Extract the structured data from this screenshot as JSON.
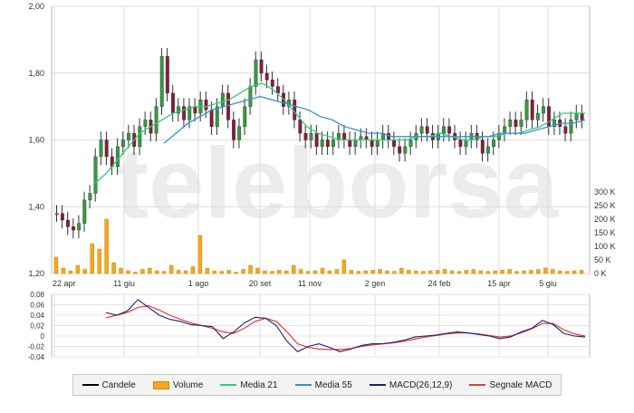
{
  "chart_data": {
    "type": "line",
    "watermark": "teleborsa",
    "price": {
      "y_ticks": [
        "2,00",
        "1,80",
        "1,60",
        "1,40",
        "1,20"
      ],
      "ylim": [
        1.2,
        2.0
      ]
    },
    "volume": {
      "y_ticks": [
        "300 K",
        "250 K",
        "200 K",
        "150 K",
        "100 K",
        "50 K",
        "0 K"
      ],
      "ylim": [
        0,
        300000
      ]
    },
    "x_ticks": [
      "22 apr",
      "11 giu",
      "1 ago",
      "20 set",
      "11 nov",
      "2 gen",
      "24 feb",
      "15 apr",
      "5 giu"
    ],
    "macd_panel": {
      "y_ticks": [
        "0,08",
        "0,06",
        "0,04",
        "0,02",
        "0",
        "-0,02",
        "-0,04"
      ],
      "ylim": [
        -0.04,
        0.08
      ]
    },
    "legend": [
      {
        "label": "Candele",
        "color": "#000000",
        "kind": "line"
      },
      {
        "label": "Volume",
        "color": "#f5a623",
        "kind": "box"
      },
      {
        "label": "Media 21",
        "color": "#33cc77",
        "kind": "line"
      },
      {
        "label": "Media 55",
        "color": "#3b8fd6",
        "kind": "line"
      },
      {
        "label": "MACD(26,12,9)",
        "color": "#1a237e",
        "kind": "line"
      },
      {
        "label": "Segnale MACD",
        "color": "#e53935",
        "kind": "line"
      }
    ],
    "candles_close_approx": [
      1.38,
      1.36,
      1.34,
      1.33,
      1.35,
      1.42,
      1.44,
      1.55,
      1.6,
      1.55,
      1.52,
      1.58,
      1.6,
      1.62,
      1.58,
      1.64,
      1.66,
      1.62,
      1.7,
      1.85,
      1.74,
      1.68,
      1.7,
      1.66,
      1.7,
      1.68,
      1.72,
      1.69,
      1.64,
      1.7,
      1.74,
      1.66,
      1.6,
      1.64,
      1.7,
      1.76,
      1.84,
      1.8,
      1.78,
      1.76,
      1.74,
      1.7,
      1.72,
      1.66,
      1.62,
      1.6,
      1.62,
      1.58,
      1.6,
      1.58,
      1.6,
      1.62,
      1.6,
      1.58,
      1.6,
      1.61,
      1.6,
      1.58,
      1.6,
      1.62,
      1.6,
      1.58,
      1.56,
      1.58,
      1.6,
      1.62,
      1.64,
      1.62,
      1.6,
      1.62,
      1.64,
      1.62,
      1.6,
      1.58,
      1.6,
      1.62,
      1.6,
      1.56,
      1.58,
      1.6,
      1.62,
      1.64,
      1.66,
      1.64,
      1.66,
      1.72,
      1.66,
      1.68,
      1.7,
      1.64,
      1.66,
      1.64,
      1.62,
      1.66,
      1.68,
      1.66
    ],
    "media21_approx": [
      1.47,
      1.5,
      1.54,
      1.58,
      1.62,
      1.64,
      1.66,
      1.68,
      1.69,
      1.7,
      1.7,
      1.71,
      1.72,
      1.74,
      1.76,
      1.77,
      1.75,
      1.72,
      1.68,
      1.64,
      1.62,
      1.61,
      1.6,
      1.6,
      1.6,
      1.6,
      1.6,
      1.6,
      1.6,
      1.61,
      1.61,
      1.62,
      1.61,
      1.6,
      1.6,
      1.61,
      1.61,
      1.62,
      1.62,
      1.63,
      1.64,
      1.66,
      1.68,
      1.68,
      1.68
    ],
    "media55_approx": [
      1.59,
      1.62,
      1.65,
      1.67,
      1.69,
      1.7,
      1.71,
      1.72,
      1.73,
      1.72,
      1.71,
      1.7,
      1.69,
      1.67,
      1.66,
      1.64,
      1.63,
      1.62,
      1.62,
      1.61,
      1.61,
      1.61,
      1.61,
      1.61,
      1.61,
      1.61,
      1.61,
      1.61,
      1.62,
      1.62,
      1.62,
      1.63,
      1.64,
      1.65,
      1.65,
      1.66
    ],
    "volume_approx": [
      60000,
      20000,
      10000,
      30000,
      15000,
      110000,
      90000,
      200000,
      40000,
      20000,
      10000,
      5000,
      15000,
      20000,
      10000,
      8000,
      30000,
      12000,
      10000,
      25000,
      140000,
      20000,
      10000,
      8000,
      12000,
      5000,
      15000,
      30000,
      20000,
      10000,
      8000,
      12000,
      10000,
      30000,
      15000,
      8000,
      10000,
      20000,
      10000,
      15000,
      50000,
      12000,
      8000,
      10000,
      12000,
      15000,
      10000,
      8000,
      20000,
      12000,
      10000,
      8000,
      10000,
      12000,
      15000,
      10000,
      8000,
      12000,
      15000,
      10000,
      8000,
      10000,
      12000,
      15000,
      8000,
      10000,
      12000,
      15000,
      20000,
      15000,
      10000,
      8000,
      10000,
      12000
    ],
    "macd_approx": [
      0.045,
      0.04,
      0.048,
      0.07,
      0.055,
      0.04,
      0.032,
      0.028,
      0.022,
      0.02,
      0.018,
      -0.005,
      0.008,
      0.025,
      0.036,
      0.034,
      0.02,
      -0.01,
      -0.03,
      -0.02,
      -0.015,
      -0.022,
      -0.03,
      -0.025,
      -0.018,
      -0.015,
      -0.015,
      -0.012,
      -0.008,
      -0.002,
      0.0,
      0.002,
      0.005,
      0.008,
      0.006,
      0.003,
      0.0,
      -0.005,
      -0.002,
      0.008,
      0.015,
      0.03,
      0.022,
      0.005,
      0.0,
      -0.002
    ],
    "signal_approx": [
      0.035,
      0.04,
      0.045,
      0.055,
      0.058,
      0.05,
      0.04,
      0.032,
      0.025,
      0.02,
      0.015,
      0.008,
      0.005,
      0.015,
      0.028,
      0.034,
      0.028,
      0.008,
      -0.015,
      -0.022,
      -0.025,
      -0.026,
      -0.026,
      -0.024,
      -0.02,
      -0.017,
      -0.015,
      -0.013,
      -0.01,
      -0.006,
      -0.002,
      0.001,
      0.004,
      0.006,
      0.006,
      0.004,
      0.001,
      -0.002,
      0.0,
      0.006,
      0.014,
      0.024,
      0.024,
      0.012,
      0.004,
      0.0
    ]
  }
}
